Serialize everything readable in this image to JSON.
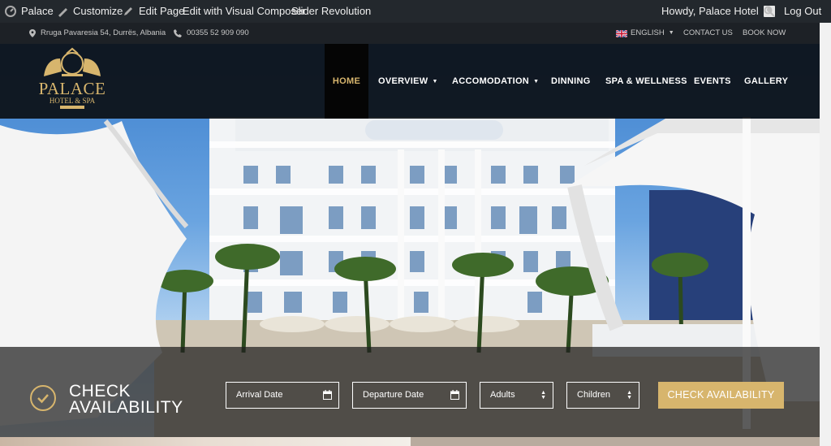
{
  "admin_bar": {
    "site_name": "Palace",
    "customize": "Customize",
    "edit_page": "Edit Page",
    "visual_composer": "Edit with Visual Composer",
    "slider": "Slider Revolution",
    "howdy": "Howdy, Palace Hotel",
    "logout": "Log Out"
  },
  "info_bar": {
    "address": "Rruga Pavaresia 54, Durrës, Albania",
    "phone": "00355 52 909 090",
    "language": "ENGLISH",
    "contact": "CONTACT US",
    "book": "BOOK NOW"
  },
  "logo": {
    "title": "PALACE",
    "subtitle": "HOTEL & SPA"
  },
  "nav": {
    "items": [
      {
        "label": "HOME",
        "active": true
      },
      {
        "label": "OVERVIEW",
        "dropdown": true
      },
      {
        "label": "ACCOMODATION",
        "dropdown": true
      },
      {
        "label": "DINNING"
      },
      {
        "label": "SPA & WELLNESS"
      },
      {
        "label": "EVENTS"
      },
      {
        "label": "GALLERY"
      }
    ]
  },
  "booking": {
    "title_line1": "CHECK",
    "title_line2": "AVAILABILITY",
    "arrival_placeholder": "Arrival Date",
    "departure_placeholder": "Departure Date",
    "adults": "Adults",
    "children": "Children",
    "button": "CHECK AVAILABILITY"
  },
  "colors": {
    "accent": "#d7b56d",
    "admin_bar": "#23282d",
    "nav_bg": "#0c1016"
  }
}
